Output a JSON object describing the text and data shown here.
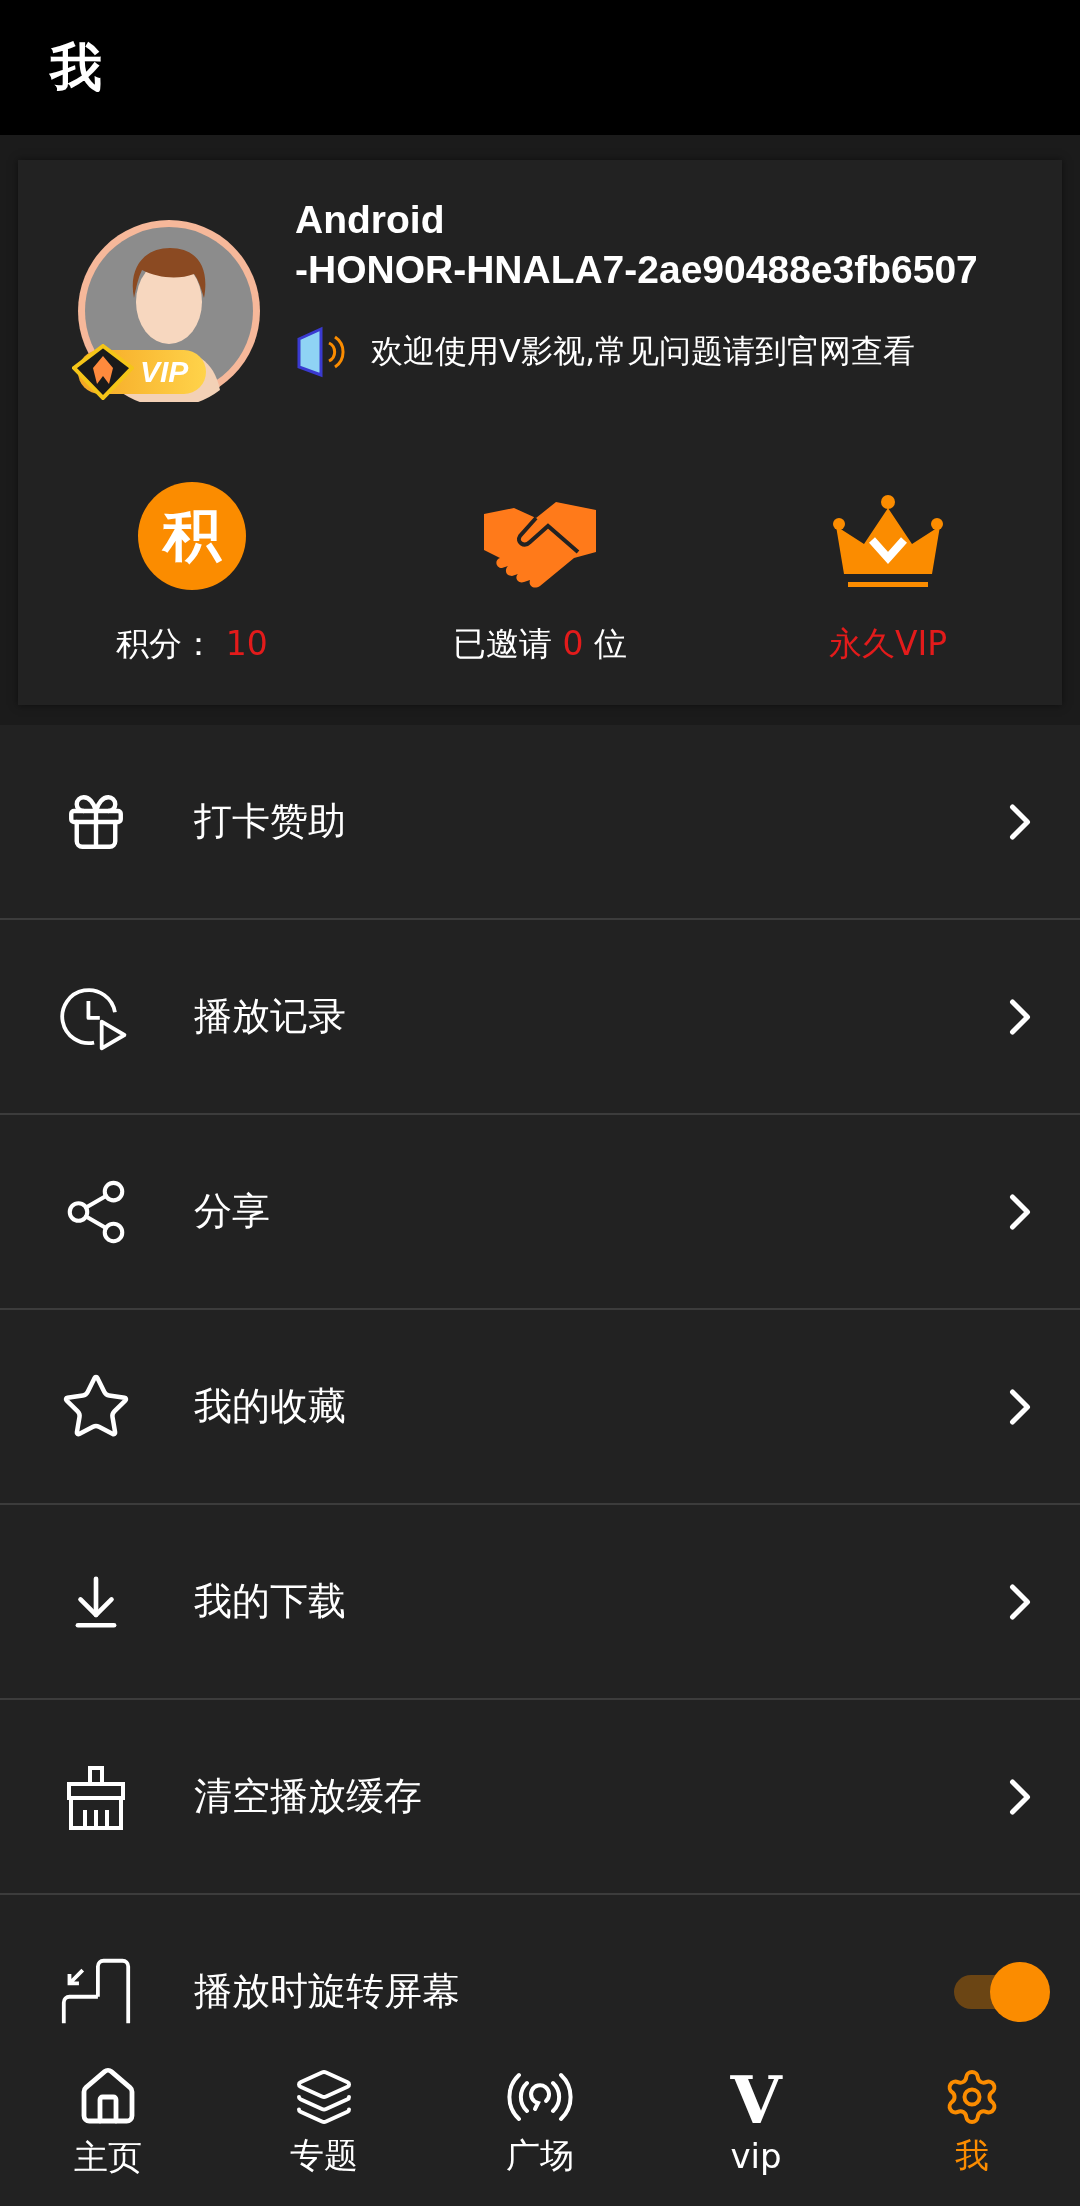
{
  "header": {
    "title": "我"
  },
  "profile": {
    "name_line_1": "Android",
    "name_line_2": "-HONOR-HNALA7-2ae90488e3fb6507",
    "vip_badge": "VIP",
    "notice": "欢迎使用V影视,常见问题请到官网查看"
  },
  "stats": [
    {
      "kind": "points",
      "icon_text": "积",
      "label": "积分：",
      "value": "10"
    },
    {
      "kind": "invite",
      "label": "已邀请",
      "value": "0",
      "suffix": "位"
    },
    {
      "kind": "vip",
      "label": "永久VIP"
    }
  ],
  "menu": [
    {
      "kind": "link",
      "label": "打卡赞助"
    },
    {
      "kind": "link",
      "label": "播放记录"
    },
    {
      "kind": "link",
      "label": "分享"
    },
    {
      "kind": "link",
      "label": "我的收藏"
    },
    {
      "kind": "link",
      "label": "我的下载"
    },
    {
      "kind": "link",
      "label": "清空播放缓存"
    },
    {
      "kind": "toggle",
      "label": "播放时旋转屏幕",
      "on": true
    }
  ],
  "nav": [
    {
      "label": "主页",
      "selected": false
    },
    {
      "label": "专题",
      "selected": false
    },
    {
      "label": "广场",
      "selected": false
    },
    {
      "glyph": "V",
      "label": "vip",
      "selected": false
    },
    {
      "label": "我",
      "selected": true
    }
  ]
}
